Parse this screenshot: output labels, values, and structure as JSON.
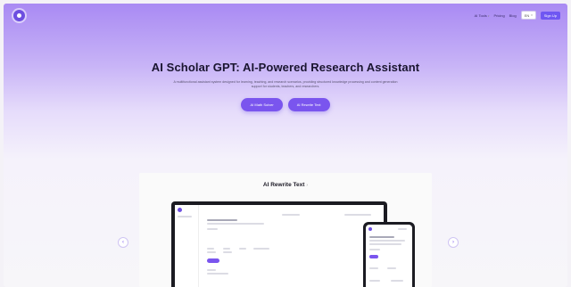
{
  "header": {
    "nav": [
      {
        "label": "AI Tools",
        "has_caret": true
      },
      {
        "label": "Pricing"
      },
      {
        "label": "Blog"
      }
    ],
    "language": {
      "value": "EN",
      "caret": "▾"
    },
    "signup_label": "Sign Up"
  },
  "hero": {
    "title": "AI Scholar GPT: AI-Powered Research Assistant",
    "subtitle": "A multifunctional assistant system designed for learning, teaching, and research scenarios, providing structured knowledge processing and content generation support for students, teachers, and researchers.",
    "cta_primary": "AI Math Solver",
    "cta_secondary": "AI Rewrite Text"
  },
  "showcase": {
    "title": "AI Rewrite Text",
    "title_chevron": "›",
    "prev_icon": "‹",
    "next_icon": "›"
  },
  "colors": {
    "accent": "#7a55ee",
    "hero_top": "#a98af3",
    "page_bg": "#f7f6f9"
  },
  "icons": [
    "logo-icon",
    "chevron-down-icon",
    "chevron-left-icon",
    "chevron-right-icon"
  ]
}
